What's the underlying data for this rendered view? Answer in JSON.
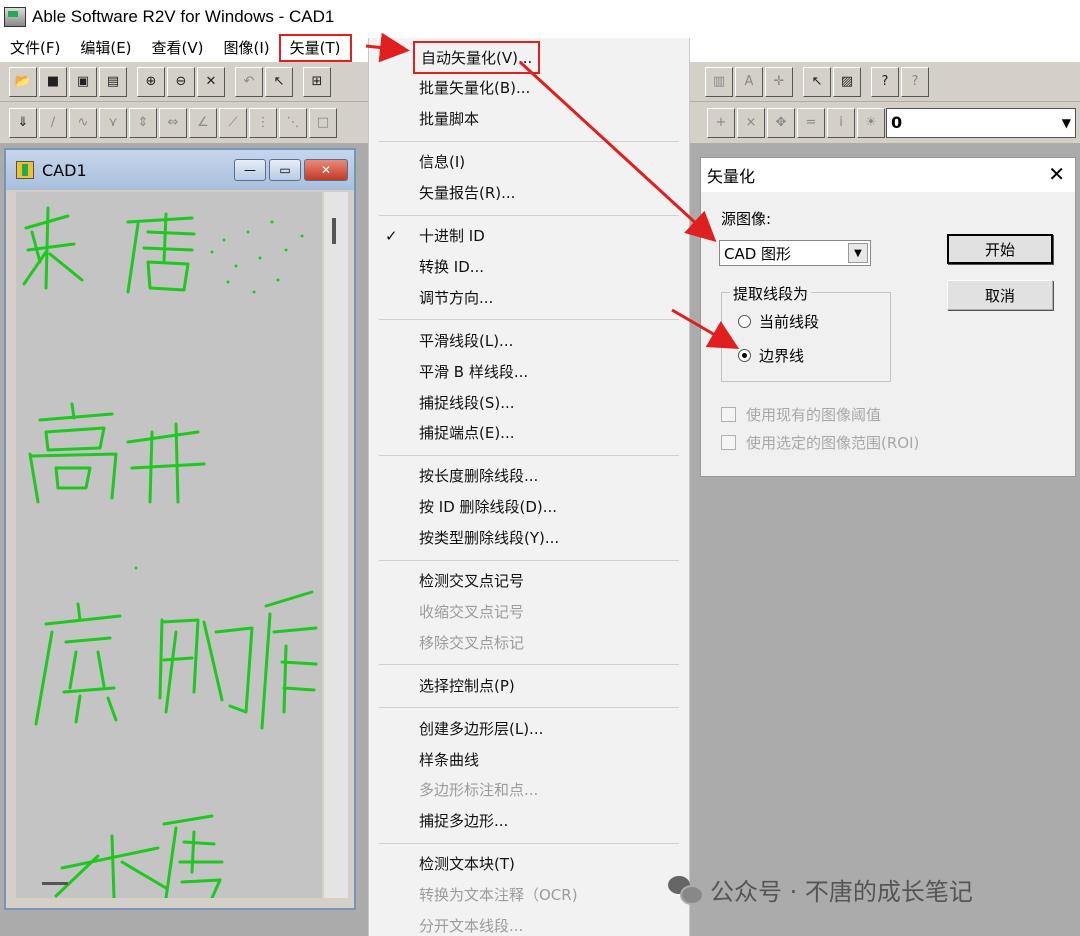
{
  "window": {
    "title": "Able Software R2V for Windows - CAD1"
  },
  "menubar": [
    "文件(F)",
    "编辑(E)",
    "查看(V)",
    "图像(I)",
    "矢量(T)"
  ],
  "layer_select": {
    "value": "0"
  },
  "doc_window": {
    "title": "CAD1"
  },
  "vector_menu": [
    {
      "label": "自动矢量化(V)...",
      "enabled": true,
      "highlighted": true
    },
    {
      "label": "批量矢量化(B)...",
      "enabled": true
    },
    {
      "label": "批量脚本",
      "enabled": true
    },
    {
      "separator": true
    },
    {
      "label": "信息(I)",
      "enabled": true
    },
    {
      "label": "矢量报告(R)...",
      "enabled": true
    },
    {
      "separator": true
    },
    {
      "label": "十进制 ID",
      "enabled": true,
      "checked": true
    },
    {
      "label": "转换 ID...",
      "enabled": true
    },
    {
      "label": "调节方向...",
      "enabled": true
    },
    {
      "separator": true
    },
    {
      "label": "平滑线段(L)...",
      "enabled": true
    },
    {
      "label": "平滑 B 样线段...",
      "enabled": true
    },
    {
      "label": "捕捉线段(S)...",
      "enabled": true
    },
    {
      "label": "捕捉端点(E)...",
      "enabled": true
    },
    {
      "separator": true
    },
    {
      "label": "按长度删除线段...",
      "enabled": true
    },
    {
      "label": "按 ID 删除线段(D)...",
      "enabled": true
    },
    {
      "label": "按类型删除线段(Y)...",
      "enabled": true
    },
    {
      "separator": true
    },
    {
      "label": "检测交叉点记号",
      "enabled": true
    },
    {
      "label": "收缩交叉点记号",
      "enabled": false
    },
    {
      "label": "移除交叉点标记",
      "enabled": false
    },
    {
      "separator": true
    },
    {
      "label": "选择控制点(P)",
      "enabled": true
    },
    {
      "separator": true
    },
    {
      "label": "创建多边形层(L)...",
      "enabled": true
    },
    {
      "label": "样条曲线",
      "enabled": true
    },
    {
      "label": "多边形标注和点...",
      "enabled": false
    },
    {
      "label": "捕捉多边形...",
      "enabled": true
    },
    {
      "separator": true
    },
    {
      "label": "检测文本块(T)",
      "enabled": true
    },
    {
      "label": "转换为文本注释（OCR)",
      "enabled": false
    },
    {
      "label": "分开文本线段...",
      "enabled": false
    }
  ],
  "dialog": {
    "title": "矢量化",
    "close": "✕",
    "source_label": "源图像:",
    "source_value": "CAD 图形",
    "group_label": "提取线段为",
    "radio_current": "当前线段",
    "radio_boundary": "边界线",
    "selected_radio": "boundary",
    "check_threshold": "使用现有的图像阈值",
    "check_roi": "使用选定的图像范围(ROI)",
    "start_button": "开始",
    "cancel_button": "取消"
  },
  "watermark": "公众号 · 不唐的成长笔记",
  "colors": {
    "annotation": "#e0201f",
    "strokes": "#1ec81e"
  }
}
